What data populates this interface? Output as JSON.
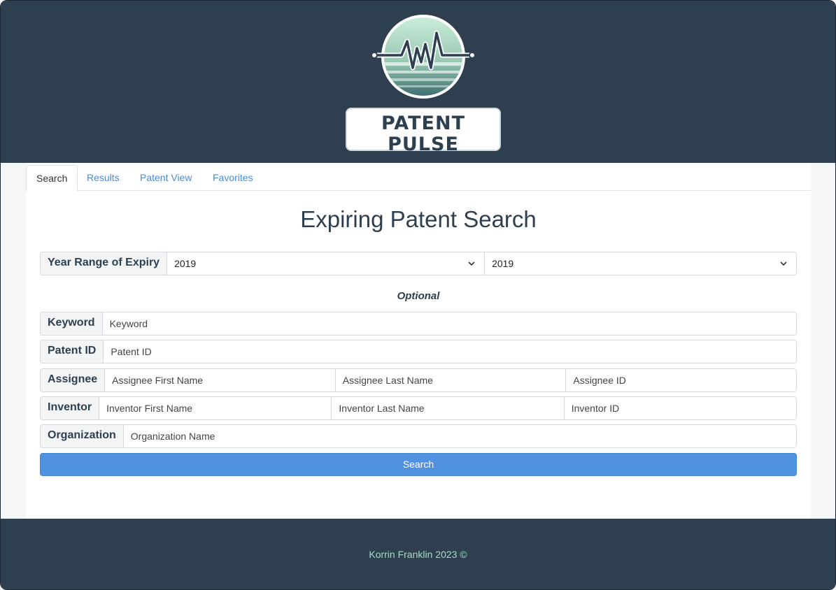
{
  "brand": {
    "name": "PATENT PULSE",
    "tagline": "Expiring Patent Search"
  },
  "tabs": [
    {
      "label": "Search",
      "active": true
    },
    {
      "label": "Results",
      "active": false
    },
    {
      "label": "Patent View",
      "active": false
    },
    {
      "label": "Favorites",
      "active": false
    }
  ],
  "main": {
    "title": "Expiring Patent Search",
    "year_range": {
      "label": "Year Range of Expiry",
      "from": "2019",
      "to": "2019"
    },
    "optional_label": "Optional",
    "keyword": {
      "label": "Keyword",
      "placeholder": "Keyword"
    },
    "patent_id": {
      "label": "Patent ID",
      "placeholder": "Patent ID"
    },
    "assignee": {
      "label": "Assignee",
      "first_placeholder": "Assignee First Name",
      "last_placeholder": "Assignee Last Name",
      "id_placeholder": "Assignee ID"
    },
    "inventor": {
      "label": "Inventor",
      "first_placeholder": "Inventor First Name",
      "last_placeholder": "Inventor Last Name",
      "id_placeholder": "Inventor ID"
    },
    "organization": {
      "label": "Organization",
      "placeholder": "Organization Name"
    },
    "search_label": "Search"
  },
  "footer": {
    "text": "Korrin Franklin 2023 ©"
  },
  "colors": {
    "header_bg": "#2e4050",
    "accent": "#5092e0",
    "link": "#4a8ad8",
    "footer_text": "#a8dcc8"
  }
}
